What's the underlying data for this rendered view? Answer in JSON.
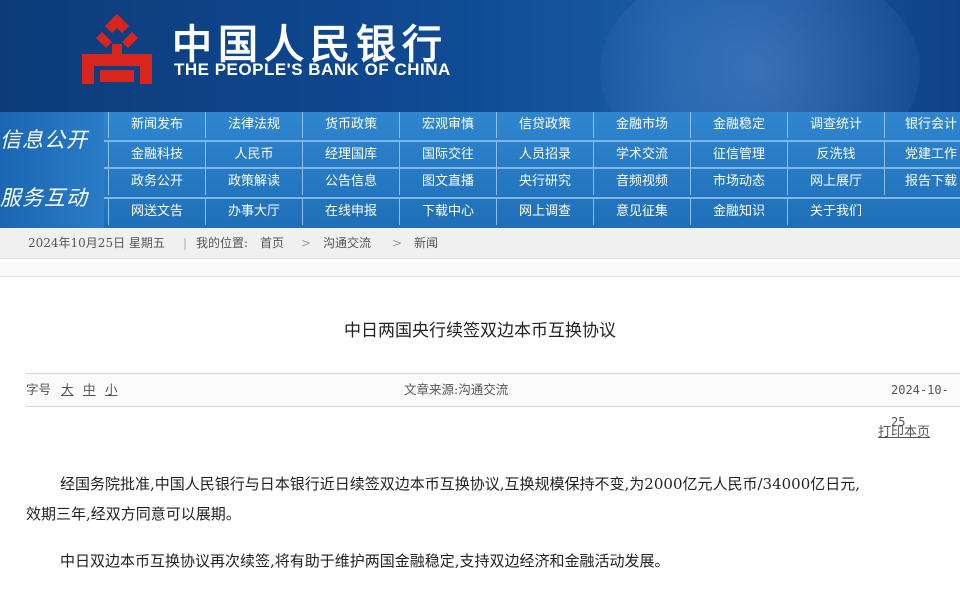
{
  "header": {
    "brand_cn": "中国人民银行",
    "brand_en": "THE PEOPLE'S BANK OF CHINA",
    "logo_icon": "pboc-emblem-icon",
    "colors": {
      "banner": "#0f4a92",
      "logo_red": "#d8261e",
      "nav": "#2a7cc6"
    }
  },
  "nav": {
    "group1": "信息公开",
    "group2": "服务互动",
    "row1": [
      "新闻发布",
      "法律法规",
      "货币政策",
      "宏观审慎",
      "信贷政策",
      "金融市场",
      "金融稳定",
      "调查统计",
      "银行会计"
    ],
    "row2": [
      "金融科技",
      "人民币",
      "经理国库",
      "国际交往",
      "人员招录",
      "学术交流",
      "征信管理",
      "反洗钱",
      "党建工作"
    ],
    "row3": [
      "政务公开",
      "政策解读",
      "公告信息",
      "图文直播",
      "央行研究",
      "音频视频",
      "市场动态",
      "网上展厅",
      "报告下载"
    ],
    "row4": [
      "网送文告",
      "办事大厅",
      "在线申报",
      "下载中心",
      "网上调查",
      "意见征集",
      "金融知识",
      "关于我们"
    ]
  },
  "breadcrumb": {
    "date": "2024年10月25日  星期五",
    "location_label": "我的位置:",
    "home": "首页",
    "section": "沟通交流",
    "current": "新闻",
    "sep": ">"
  },
  "article": {
    "title": "中日两国央行续签双边本币互换协议",
    "font_label": "字号",
    "size_large": "大",
    "size_medium": "中",
    "size_small": "小",
    "source": "文章来源:沟通交流",
    "date": "2024-10-25",
    "print": "打印本页",
    "para1_line1": "经国务院批准,中国人民银行与日本银行近日续签双边本币互换协议,互换规模保持不变,为2000亿元人民币/34000亿日元,",
    "para1_line2": "效期三年,经双方同意可以展期。",
    "para2": "中日双边本币互换协议再次续签,将有助于维护两国金融稳定,支持双边经济和金融活动发展。"
  }
}
